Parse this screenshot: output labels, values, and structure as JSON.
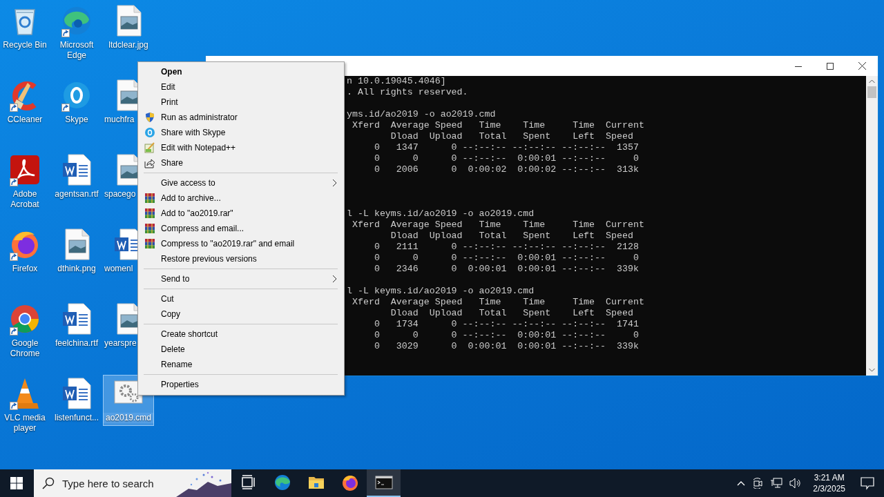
{
  "desktop_icons": [
    {
      "label": "Recycle Bin",
      "kind": "recycle",
      "shortcut": false,
      "selected": false,
      "cut": false
    },
    {
      "label": "CCleaner",
      "kind": "ccleaner",
      "shortcut": true,
      "selected": false,
      "cut": false
    },
    {
      "label": "Adobe Acrobat",
      "kind": "acrobat",
      "shortcut": true,
      "selected": false,
      "cut": false
    },
    {
      "label": "Firefox",
      "kind": "firefox",
      "shortcut": true,
      "selected": false,
      "cut": false
    },
    {
      "label": "Google Chrome",
      "kind": "chrome",
      "shortcut": true,
      "selected": false,
      "cut": false
    },
    {
      "label": "VLC media player",
      "kind": "vlc",
      "shortcut": true,
      "selected": false,
      "cut": false
    },
    {
      "label": "Microsoft Edge",
      "kind": "edge",
      "shortcut": true,
      "selected": false,
      "cut": false
    },
    {
      "label": "Skype",
      "kind": "skype",
      "shortcut": true,
      "selected": false,
      "cut": false
    },
    {
      "label": "agentsan.rtf",
      "kind": "word",
      "shortcut": false,
      "selected": false,
      "cut": false
    },
    {
      "label": "dthink.png",
      "kind": "image",
      "shortcut": false,
      "selected": false,
      "cut": false
    },
    {
      "label": "feelchina.rtf",
      "kind": "word",
      "shortcut": false,
      "selected": false,
      "cut": false
    },
    {
      "label": "listenfunct...",
      "kind": "word",
      "shortcut": false,
      "selected": false,
      "cut": false
    },
    {
      "label": "ltdclear.jpg",
      "kind": "image",
      "shortcut": false,
      "selected": false,
      "cut": false
    },
    {
      "label": "muchfra",
      "kind": "image",
      "shortcut": false,
      "selected": false,
      "cut": true
    },
    {
      "label": "spacego",
      "kind": "image",
      "shortcut": false,
      "selected": false,
      "cut": true
    },
    {
      "label": "womenl",
      "kind": "word",
      "shortcut": false,
      "selected": false,
      "cut": true
    },
    {
      "label": "yearspre",
      "kind": "image",
      "shortcut": false,
      "selected": false,
      "cut": true
    },
    {
      "label": "ao2019.cmd",
      "kind": "cmd",
      "shortcut": false,
      "selected": true,
      "cut": false
    }
  ],
  "console_window": {
    "blocks": [
      {
        "lines": [
          "n 10.0.19045.4046]",
          ". All rights reserved."
        ]
      },
      {
        "lines": [
          "yms.id/ao2019 -o ao2019.cmd",
          " Xferd  Average Speed   Time    Time     Time  Current",
          "        Dload  Upload   Total   Spent    Left  Speed",
          "     0   1347      0 --:--:-- --:--:-- --:--:--  1357",
          "     0      0      0 --:--:--  0:00:01 --:--:--     0",
          "     0   2006      0  0:00:02  0:00:02 --:--:--  313k"
        ]
      },
      {
        "lines": [
          "l -L keyms.id/ao2019 -o ao2019.cmd",
          " Xferd  Average Speed   Time    Time     Time  Current",
          "        Dload  Upload   Total   Spent    Left  Speed",
          "     0   2111      0 --:--:-- --:--:-- --:--:--  2128",
          "     0      0      0 --:--:--  0:00:01 --:--:--     0",
          "     0   2346      0  0:00:01  0:00:01 --:--:--  339k"
        ]
      },
      {
        "lines": [
          "l -L keyms.id/ao2019 -o ao2019.cmd",
          " Xferd  Average Speed   Time    Time     Time  Current",
          "        Dload  Upload   Total   Spent    Left  Speed",
          "     0   1734      0 --:--:-- --:--:-- --:--:--  1741",
          "     0      0      0 --:--:--  0:00:01 --:--:--     0",
          "     0   3029      0  0:00:01  0:00:01 --:--:--  339k"
        ]
      }
    ]
  },
  "context_menu": {
    "sections": [
      {
        "items": [
          {
            "label": "Open",
            "kind": "plain",
            "default": true,
            "submenu": false
          },
          {
            "label": "Edit",
            "kind": "plain",
            "default": false,
            "submenu": false
          },
          {
            "label": "Print",
            "kind": "plain",
            "default": false,
            "submenu": false
          },
          {
            "label": "Run as administrator",
            "kind": "shield",
            "default": false,
            "submenu": false
          },
          {
            "label": "Share with Skype",
            "kind": "skype",
            "default": false,
            "submenu": false
          },
          {
            "label": "Edit with Notepad++",
            "kind": "notepad",
            "default": false,
            "submenu": false
          },
          {
            "label": "Share",
            "kind": "share",
            "default": false,
            "submenu": false
          }
        ]
      },
      {
        "items": [
          {
            "label": "Give access to",
            "kind": "plain",
            "default": false,
            "submenu": true
          },
          {
            "label": "Add to archive...",
            "kind": "archive",
            "default": false,
            "submenu": false
          },
          {
            "label": "Add to \"ao2019.rar\"",
            "kind": "archive",
            "default": false,
            "submenu": false
          },
          {
            "label": "Compress and email...",
            "kind": "archive",
            "default": false,
            "submenu": false
          },
          {
            "label": "Compress to \"ao2019.rar\" and email",
            "kind": "archive",
            "default": false,
            "submenu": false
          },
          {
            "label": "Restore previous versions",
            "kind": "plain",
            "default": false,
            "submenu": false
          }
        ]
      },
      {
        "items": [
          {
            "label": "Send to",
            "kind": "plain",
            "default": false,
            "submenu": true
          }
        ]
      },
      {
        "items": [
          {
            "label": "Cut",
            "kind": "plain",
            "default": false,
            "submenu": false
          },
          {
            "label": "Copy",
            "kind": "plain",
            "default": false,
            "submenu": false
          }
        ]
      },
      {
        "items": [
          {
            "label": "Create shortcut",
            "kind": "plain",
            "default": false,
            "submenu": false
          },
          {
            "label": "Delete",
            "kind": "plain",
            "default": false,
            "submenu": false
          },
          {
            "label": "Rename",
            "kind": "plain",
            "default": false,
            "submenu": false
          }
        ]
      },
      {
        "items": [
          {
            "label": "Properties",
            "kind": "plain",
            "default": false,
            "submenu": false
          }
        ]
      }
    ]
  },
  "taskbar": {
    "search": {
      "placeholder": "Type here to search"
    },
    "apps": [
      {
        "kind": "taskview",
        "active": false
      },
      {
        "kind": "edge",
        "active": false
      },
      {
        "kind": "explorer",
        "active": false
      },
      {
        "kind": "firefox",
        "active": false
      },
      {
        "kind": "console",
        "active": true
      }
    ],
    "clock": {
      "time": "3:21 AM",
      "date": "2/3/2025"
    }
  }
}
